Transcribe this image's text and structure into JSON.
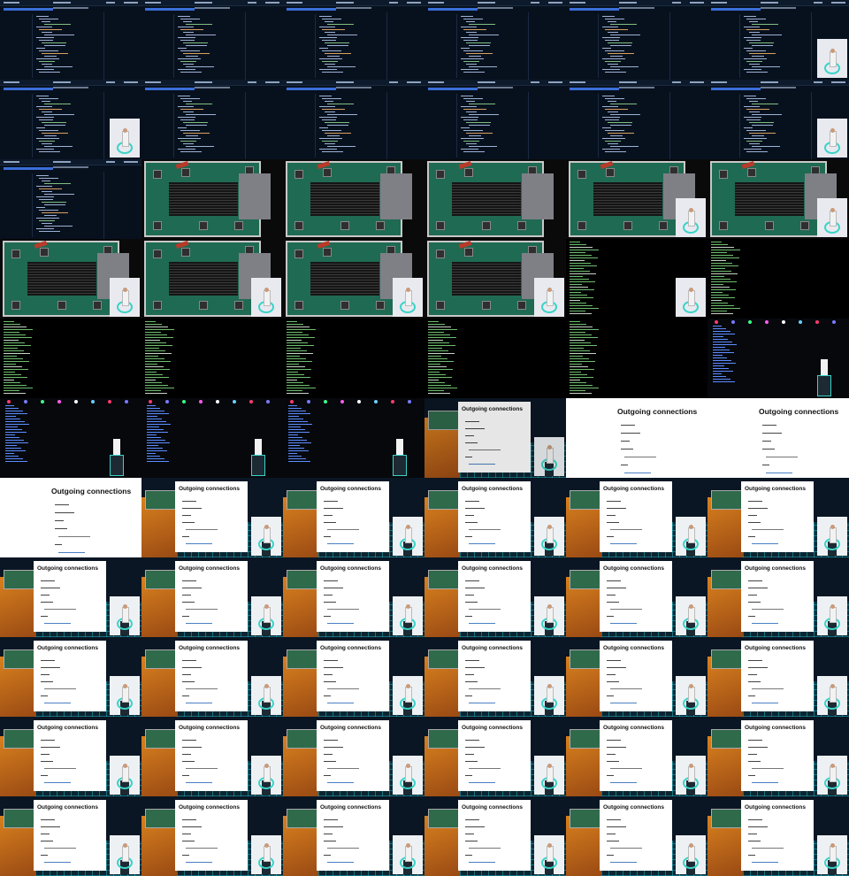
{
  "contact_sheet": {
    "columns": 6,
    "rows": 11,
    "frames": [
      "code",
      "code",
      "code",
      "code",
      "code",
      "code-speaker",
      "code-speaker",
      "code",
      "code",
      "code",
      "code",
      "code-speaker",
      "code",
      "hardware",
      "hardware",
      "hardware",
      "hardware-speaker",
      "hardware-speaker",
      "hardware-speaker",
      "hardware-speaker",
      "hardware-speaker",
      "hardware-speaker",
      "terminal-speaker",
      "terminal",
      "terminal",
      "terminal",
      "terminal",
      "terminal",
      "terminal",
      "stage",
      "stage",
      "stage",
      "stage",
      "slide-photo",
      "slide-full",
      "slide-full",
      "slide-full",
      "slide",
      "slide",
      "slide",
      "slide",
      "slide",
      "slide",
      "slide",
      "slide",
      "slide",
      "slide",
      "slide",
      "slide",
      "slide",
      "slide",
      "slide",
      "slide",
      "slide",
      "slide",
      "slide",
      "slide",
      "slide",
      "slide",
      "slide",
      "slide",
      "slide",
      "slide",
      "slide",
      "slide",
      "slide"
    ]
  },
  "slide": {
    "title": "Outgoing connections"
  },
  "colors": {
    "code_bg": "#07111e",
    "slide_bg": "#ffffff",
    "accent_teal": "#3ad3c8",
    "desk_orange": "#d8801e"
  }
}
